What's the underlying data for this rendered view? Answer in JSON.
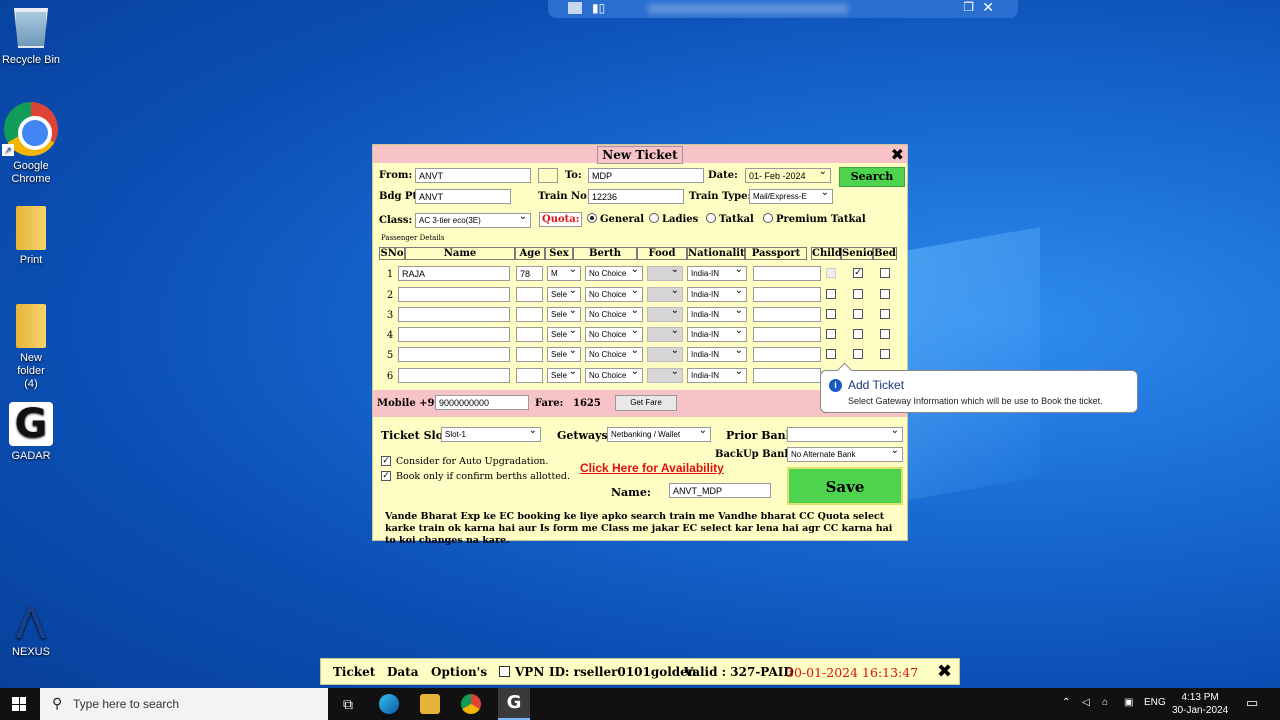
{
  "desktop": {
    "icons": [
      {
        "label": "Recycle Bin"
      },
      {
        "label": "Google Chrome"
      },
      {
        "label": "Print"
      },
      {
        "label": "New folder (4)"
      },
      {
        "label": "GADAR"
      },
      {
        "label": "NEXUS"
      }
    ]
  },
  "ticket_window": {
    "title": "New Ticket",
    "from_label": "From:",
    "from_value": "ANVT",
    "to_label": "To:",
    "to_value": "MDP",
    "date_label": "Date:",
    "date_value": "01- Feb -2024",
    "search_label": "Search",
    "bdg_label": "Bdg Pt:",
    "bdg_value": "ANVT",
    "train_no_label": "Train No:",
    "train_no_value": "12236",
    "train_type_label": "Train Type:",
    "train_type_value": "Mail/Express-E",
    "class_label": "Class:",
    "class_value": "AC 3-tier eco(3E)",
    "quota_label": "Quota:",
    "quota_options": [
      "General",
      "Ladies",
      "Tatkal",
      "Premium Tatkal"
    ],
    "passenger_section": "Passenger Details",
    "columns": [
      "SNo",
      "Name",
      "Age",
      "Sex",
      "Berth",
      "Food",
      "Nationality",
      "Passport",
      "Child",
      "Senior",
      "Bed"
    ],
    "passengers": [
      {
        "sno": "1",
        "name": "RAJA",
        "age": "78",
        "sex": "M",
        "berth": "No Choice",
        "nationality": "India-IN",
        "senior": true
      },
      {
        "sno": "2",
        "name": "",
        "age": "",
        "sex": "Sele",
        "berth": "No Choice",
        "nationality": "India-IN",
        "senior": false
      },
      {
        "sno": "3",
        "name": "",
        "age": "",
        "sex": "Sele",
        "berth": "No Choice",
        "nationality": "India-IN",
        "senior": false
      },
      {
        "sno": "4",
        "name": "",
        "age": "",
        "sex": "Sele",
        "berth": "No Choice",
        "nationality": "India-IN",
        "senior": false
      },
      {
        "sno": "5",
        "name": "",
        "age": "",
        "sex": "Sele",
        "berth": "No Choice",
        "nationality": "India-IN",
        "senior": false
      },
      {
        "sno": "6",
        "name": "",
        "age": "",
        "sex": "Sele",
        "berth": "No Choice",
        "nationality": "India-IN",
        "senior": false
      }
    ],
    "mobile_label": "Mobile +91",
    "mobile_value": "9000000000",
    "fare_label": "Fare:",
    "fare_value": "1625",
    "get_fare_label": "Get Fare",
    "ticket_slot_label": "Ticket Slot:",
    "ticket_slot_value": "Slot-1",
    "getways_label": "Getways:",
    "getways_value": "Netbanking / Wallet",
    "prior_bank_label": "Prior Bank:",
    "backup_bank_label": "BackUp Bank:",
    "backup_bank_value": "No Alternate Bank",
    "auto_upgrade_label": "Consider for Auto Upgradation.",
    "confirm_berths_label": "Book only if confirm berths allotted.",
    "availability_link": "Click Here for Availability",
    "name_label": "Name:",
    "name_value": "ANVT_MDP",
    "save_label": "Save",
    "note": "Vande Bharat Exp ke EC booking ke liye apko search train me Vandhe bharat CC Quota select karke train ok karna hai aur Is form me Class me jakar EC select kar lena hai agr CC karna hai to koi changes na kare."
  },
  "tooltip": {
    "title": "Add Ticket",
    "text": "Select Gateway Information which will be use to Book the ticket."
  },
  "app_bar": {
    "menu": [
      "Ticket",
      "Data",
      "Option's"
    ],
    "vpn_label": "VPN",
    "id_text": "ID: rseller0101golden",
    "valid_text": "Valid : 327-PAID",
    "datetime": "30-01-2024 16:13:47"
  },
  "taskbar": {
    "search_placeholder": "Type here to search",
    "language": "ENG",
    "time": "4:13 PM",
    "date": "30-Jan-2024"
  }
}
